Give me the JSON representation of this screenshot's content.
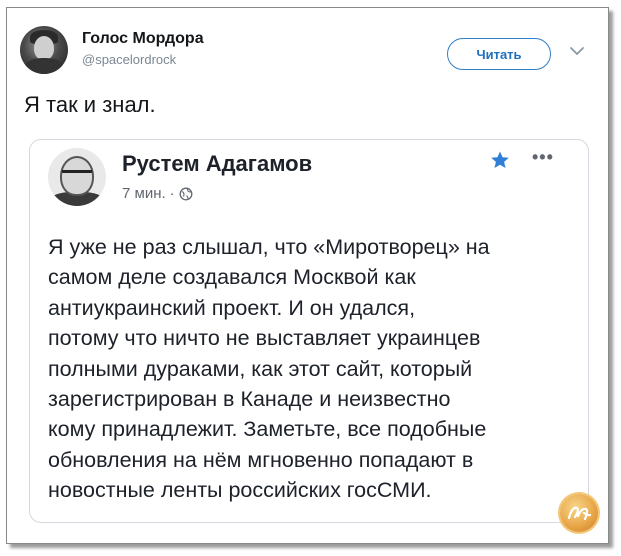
{
  "tweet": {
    "author_name": "Голос Мордора",
    "author_handle": "@spacelordrock",
    "follow_label": "Читать",
    "text": "Я так и знал."
  },
  "embedded_post": {
    "author_name": "Рустем Адагамов",
    "time": "7 мин.",
    "separator": "·",
    "lines": [
      "Я уже не раз слышал, что «Миротворец» на",
      "самом деле создавался Москвой как",
      "антиукраинский проект. И он удался,",
      "потому что ничто не выставляет украинцев",
      "полными дураками, как этот сайт, который",
      "зарегистрирован в Канаде и неизвестно",
      "кому принадлежит. Заметьте, все подобные",
      "обновления на нём мгновенно попадают в",
      "новостные ленты российских госСМИ."
    ],
    "more_label": "•••"
  },
  "colors": {
    "accent": "#1f6fbd",
    "star": "#2f7fd8",
    "text": "#1d2129",
    "muted": "#7a8792"
  },
  "icons": {
    "caret": "chevron-down-icon",
    "star": "star-icon",
    "globe": "globe-icon",
    "more": "more-icon"
  }
}
